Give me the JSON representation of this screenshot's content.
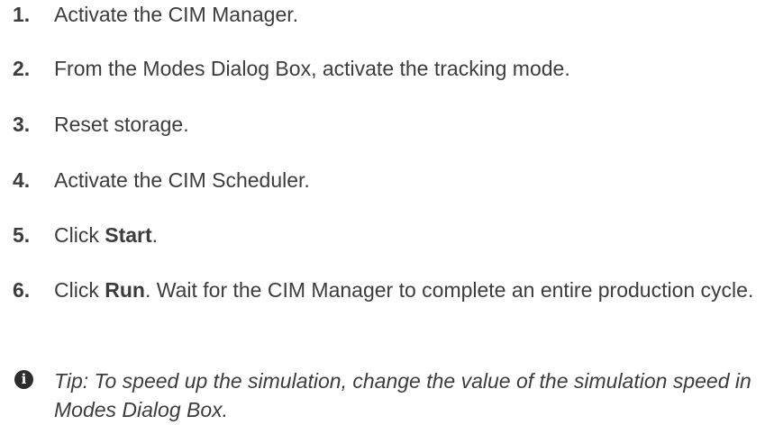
{
  "steps": [
    {
      "number": "1.",
      "text": "Activate the CIM Manager."
    },
    {
      "number": "2.",
      "text": "From the Modes Dialog Box, activate the tracking mode."
    },
    {
      "number": "3.",
      "text": "Reset storage."
    },
    {
      "number": "4.",
      "text": "Activate the CIM Scheduler."
    },
    {
      "number": "5.",
      "pre": "Click ",
      "bold": "Start",
      "post": "."
    },
    {
      "number": "6.",
      "pre": "Click ",
      "bold": "Run",
      "post": ". Wait for the CIM Manager to complete an entire production cycle."
    }
  ],
  "tip": {
    "icon": "info-icon",
    "icon_glyph": "i",
    "text": "Tip: To speed up the simulation, change the value of the simulation speed in Modes Dialog Box."
  }
}
